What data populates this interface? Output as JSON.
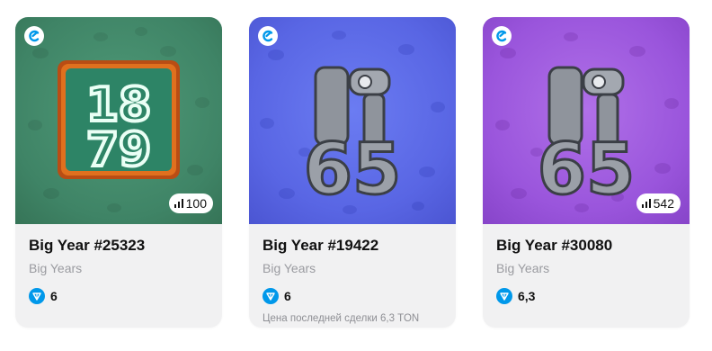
{
  "cards": [
    {
      "title": "Big Year #25323",
      "collection": "Big Years",
      "price": "6",
      "badge": "100",
      "art_text": [
        "18",
        "79"
      ],
      "last_sale": ""
    },
    {
      "title": "Big Year #19422",
      "collection": "Big Years",
      "price": "6",
      "badge": "",
      "art_text": [
        "65"
      ],
      "last_sale": "Цена последней сделки 6,3 TON"
    },
    {
      "title": "Big Year #30080",
      "collection": "Big Years",
      "price": "6,3",
      "badge": "542",
      "art_text": [
        "65"
      ],
      "last_sale": ""
    }
  ],
  "colors": {
    "ton_blue": "#0098ea",
    "card_bg": "#f1f1f2",
    "green_bg": "#3f8466",
    "blue_bg": "#5966e4",
    "purple_bg": "#9a55dc"
  },
  "icons": {
    "brand": "getgems-logo-icon",
    "currency": "ton-diamond-icon",
    "badge": "signal-bars-icon"
  }
}
